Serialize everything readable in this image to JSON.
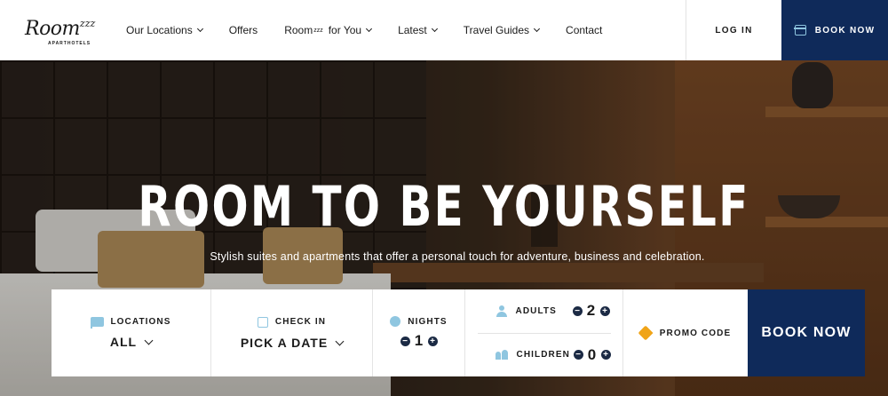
{
  "logo": {
    "word": "Room",
    "sup": "zzz",
    "sub": "APARTHOTELS"
  },
  "nav": [
    {
      "label": "Our Locations",
      "sup": "",
      "dropdown": true
    },
    {
      "label": "Offers",
      "sup": "",
      "dropdown": false
    },
    {
      "label": "Room",
      "sup": "zzz",
      "suffix": "for You",
      "dropdown": true
    },
    {
      "label": "Latest",
      "sup": "",
      "dropdown": true
    },
    {
      "label": "Travel Guides",
      "sup": "",
      "dropdown": true
    },
    {
      "label": "Contact",
      "sup": "",
      "dropdown": false
    }
  ],
  "header": {
    "login": "LOG IN",
    "book": "BOOK NOW"
  },
  "hero": {
    "title": "ROOM TO BE YOURSELF",
    "subtitle": "Stylish suites and apartments that offer a personal touch for adventure, business and celebration."
  },
  "booking": {
    "locations": {
      "label": "LOCATIONS",
      "value": "ALL"
    },
    "checkin": {
      "label": "CHECK IN",
      "value": "PICK A DATE"
    },
    "nights": {
      "label": "NIGHTS",
      "value": "1",
      "minus": "−",
      "plus": "+"
    },
    "adults": {
      "label": "ADULTS",
      "value": "2",
      "minus": "−",
      "plus": "+"
    },
    "children": {
      "label": "CHILDREN",
      "value": "0",
      "minus": "−",
      "plus": "+"
    },
    "promo": {
      "label": "PROMO CODE"
    },
    "book": "BOOK NOW"
  },
  "colors": {
    "navy": "#0f2a5a",
    "accent_blue": "#8fc6e0",
    "promo_tag": "#f0a418"
  },
  "icons": [
    "calendar-icon",
    "bed-icon",
    "moon-icon",
    "person-icon",
    "children-icon",
    "tag-icon",
    "chevron-down-icon",
    "minus-icon",
    "plus-icon"
  ]
}
